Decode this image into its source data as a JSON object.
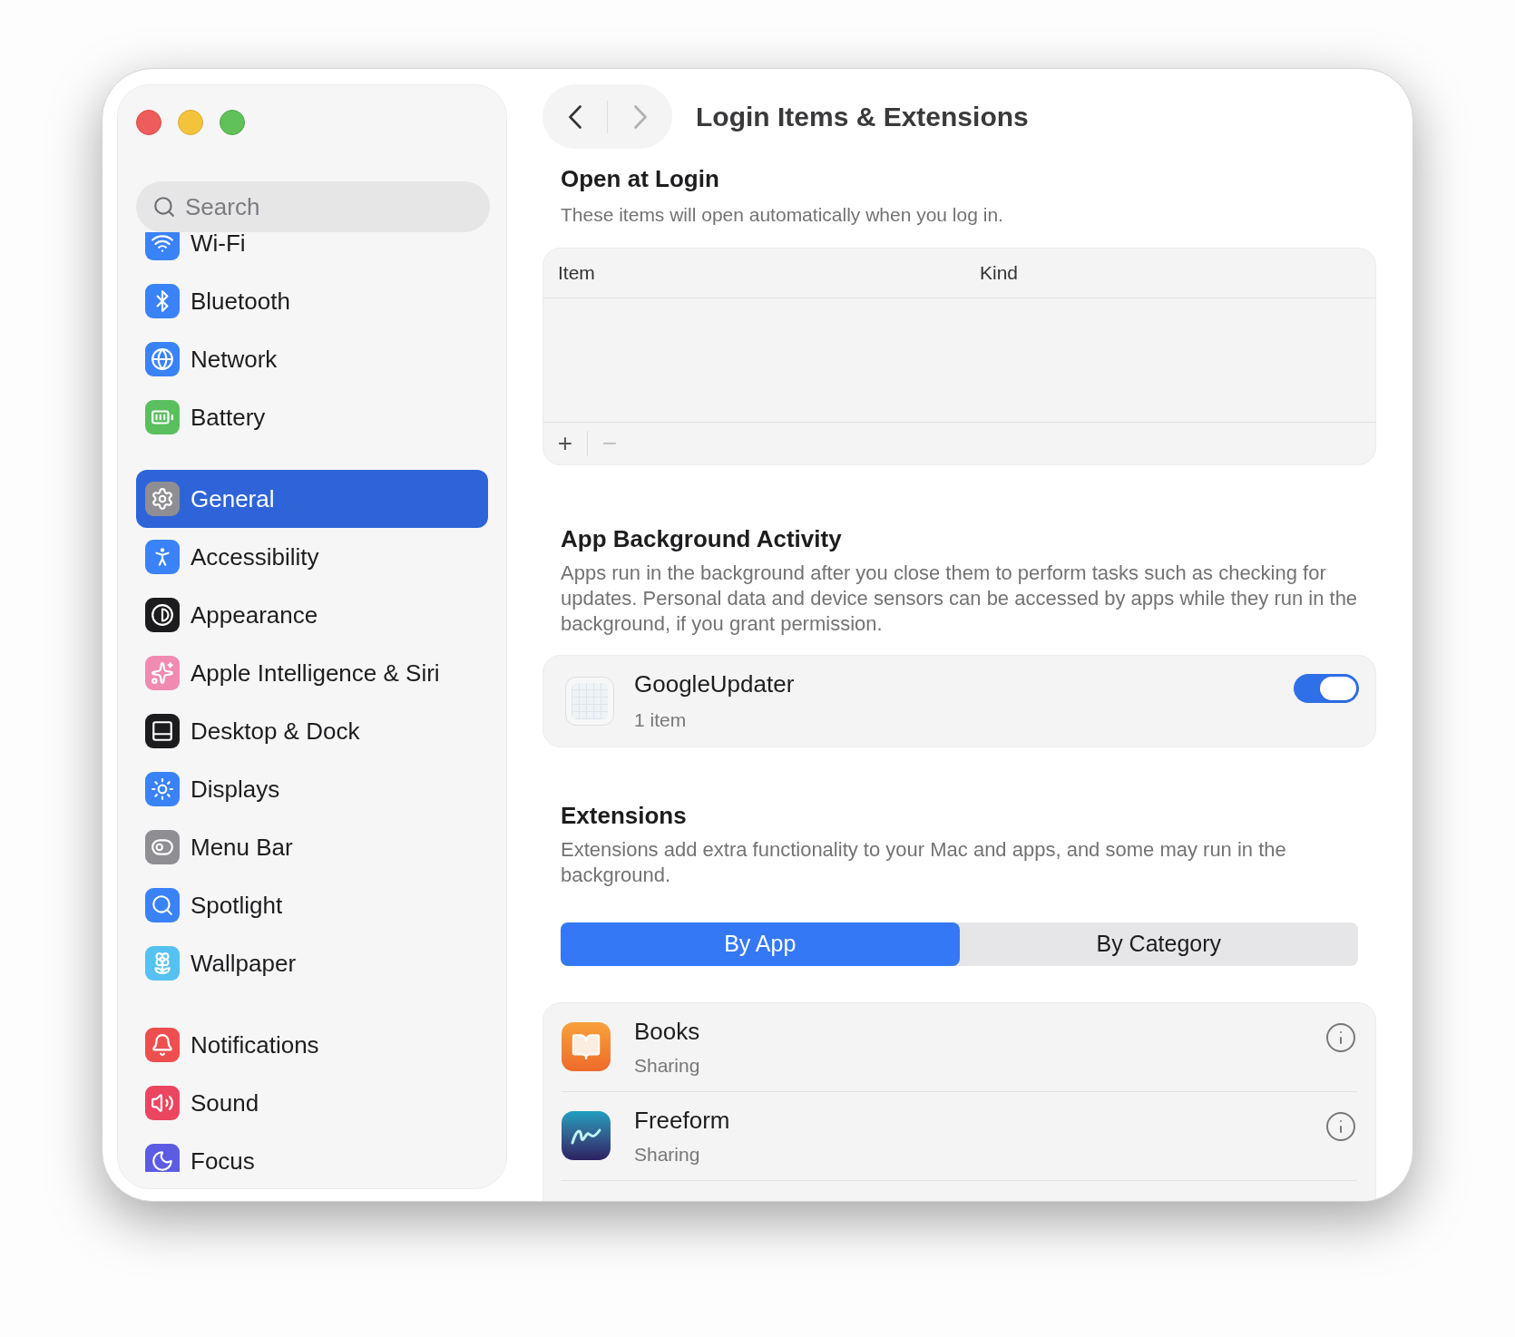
{
  "window": {
    "title": "Login Items & Extensions"
  },
  "sidebar": {
    "search": {
      "placeholder": "Search"
    },
    "groups": [
      {
        "items": [
          {
            "label": "Wi-Fi",
            "selected": false
          },
          {
            "label": "Bluetooth",
            "selected": false
          },
          {
            "label": "Network",
            "selected": false
          },
          {
            "label": "Battery",
            "selected": false
          }
        ]
      },
      {
        "items": [
          {
            "label": "General",
            "selected": true
          },
          {
            "label": "Accessibility",
            "selected": false
          },
          {
            "label": "Appearance",
            "selected": false
          },
          {
            "label": "Apple Intelligence & Siri",
            "selected": false
          },
          {
            "label": "Desktop & Dock",
            "selected": false
          },
          {
            "label": "Displays",
            "selected": false
          },
          {
            "label": "Menu Bar",
            "selected": false
          },
          {
            "label": "Spotlight",
            "selected": false
          },
          {
            "label": "Wallpaper",
            "selected": false
          }
        ]
      },
      {
        "items": [
          {
            "label": "Notifications",
            "selected": false
          },
          {
            "label": "Sound",
            "selected": false
          },
          {
            "label": "Focus",
            "selected": false
          }
        ]
      }
    ]
  },
  "open_at_login": {
    "title": "Open at Login",
    "description": "These items will open automatically when you log in.",
    "table": {
      "columns": [
        "Item",
        "Kind"
      ]
    },
    "buttons": [
      {
        "label": "+",
        "disabled": false
      },
      {
        "label": "−",
        "disabled": true
      }
    ]
  },
  "background_activity": {
    "title": "App Background Activity",
    "description": "Apps run in the background after you close them to perform tasks such as checking for updates. Personal data and device sensors can be accessed by apps while they run in the background, if you grant permission.",
    "items": [
      {
        "name": "GoogleUpdater",
        "detail": "1 item",
        "on": true
      }
    ]
  },
  "extensions": {
    "title": "Extensions",
    "description": "Extensions add extra functionality to your Mac and apps, and some may run in the background.",
    "segments": [
      {
        "label": "By App",
        "selected": true
      },
      {
        "label": "By Category",
        "selected": false
      }
    ],
    "apps": [
      {
        "name": "Books",
        "detail": "Sharing"
      },
      {
        "name": "Freeform",
        "detail": "Sharing"
      }
    ]
  }
}
